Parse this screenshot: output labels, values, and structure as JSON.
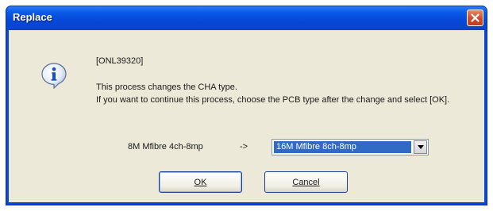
{
  "window": {
    "title": "Replace"
  },
  "message": {
    "code": "[ONL39320]",
    "line1": "This process changes the CHA type.",
    "line2": "If you want to continue this process, choose the PCB type after the change and select [OK]."
  },
  "conversion": {
    "from_label": "8M Mfibre 4ch-8mp",
    "arrow": "->",
    "select_value": "16M Mfibre 8ch-8mp"
  },
  "buttons": {
    "ok_label": "OK",
    "cancel_label": "Cancel"
  },
  "icons": {
    "info": "info-icon",
    "close": "close-icon",
    "dropdown": "chevron-down-icon"
  },
  "colors": {
    "titlebar": "#0a5be8",
    "client_bg": "#ece9d8",
    "close_button": "#cf4a2b",
    "selection": "#316ac5"
  }
}
